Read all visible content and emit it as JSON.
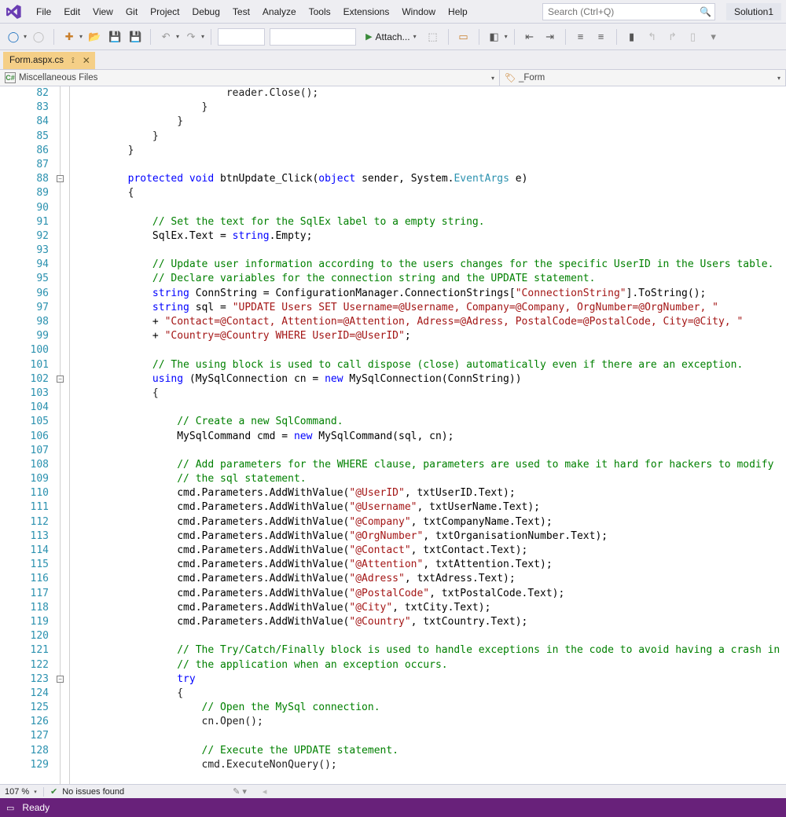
{
  "menu": {
    "items": [
      "File",
      "Edit",
      "View",
      "Git",
      "Project",
      "Debug",
      "Test",
      "Analyze",
      "Tools",
      "Extensions",
      "Window",
      "Help"
    ]
  },
  "search": {
    "placeholder": "Search (Ctrl+Q)"
  },
  "solution_label": "Solution1",
  "toolbar": {
    "attach_label": "Attach..."
  },
  "tab": {
    "title": "Form.aspx.cs"
  },
  "nav": {
    "left": "Miscellaneous Files",
    "right": "_Form"
  },
  "line_start": 82,
  "code": [
    "                        reader.Close();",
    "                    }",
    "                }",
    "            }",
    "        }",
    "",
    {
      "seg": [
        [
          "        ",
          "p"
        ],
        [
          "protected",
          "k"
        ],
        [
          " ",
          "p"
        ],
        [
          "void",
          "k"
        ],
        [
          " btnUpdate_Click(",
          "p"
        ],
        [
          "object",
          "k"
        ],
        [
          " sender, System.",
          "p"
        ],
        [
          "EventArgs",
          "t"
        ],
        [
          " e)",
          "p"
        ]
      ]
    },
    "        {",
    "",
    {
      "seg": [
        [
          "            ",
          "p"
        ],
        [
          "// Set the text for the SqlEx label to a empty string.",
          "c"
        ]
      ]
    },
    {
      "seg": [
        [
          "            SqlEx.Text = ",
          "p"
        ],
        [
          "string",
          "k"
        ],
        [
          ".Empty;",
          "p"
        ]
      ]
    },
    "",
    {
      "seg": [
        [
          "            ",
          "p"
        ],
        [
          "// Update user information according to the users changes for the specific UserID in the Users table.",
          "c"
        ]
      ]
    },
    {
      "seg": [
        [
          "            ",
          "p"
        ],
        [
          "// Declare variables for the connection string and the UPDATE statement.",
          "c"
        ]
      ]
    },
    {
      "seg": [
        [
          "            ",
          "p"
        ],
        [
          "string",
          "k"
        ],
        [
          " ConnString = ConfigurationManager.ConnectionStrings[",
          "p"
        ],
        [
          "\"ConnectionString\"",
          "s"
        ],
        [
          "].ToString();",
          "p"
        ]
      ]
    },
    {
      "seg": [
        [
          "            ",
          "p"
        ],
        [
          "string",
          "k"
        ],
        [
          " sql = ",
          "p"
        ],
        [
          "\"UPDATE Users SET Username=@Username, Company=@Company, OrgNumber=@OrgNumber, \"",
          "s"
        ]
      ]
    },
    {
      "seg": [
        [
          "            + ",
          "p"
        ],
        [
          "\"Contact=@Contact, Attention=@Attention, Adress=@Adress, PostalCode=@PostalCode, City=@City, \"",
          "s"
        ]
      ]
    },
    {
      "seg": [
        [
          "            + ",
          "p"
        ],
        [
          "\"Country=@Country WHERE UserID=@UserID\"",
          "s"
        ],
        [
          ";",
          "p"
        ]
      ]
    },
    "",
    {
      "seg": [
        [
          "            ",
          "p"
        ],
        [
          "// The using block is used to call dispose (close) automatically even if there are an exception.",
          "c"
        ]
      ]
    },
    {
      "seg": [
        [
          "            ",
          "p"
        ],
        [
          "using",
          "k"
        ],
        [
          " (MySqlConnection cn = ",
          "p"
        ],
        [
          "new",
          "k"
        ],
        [
          " MySqlConnection(ConnString))",
          "p"
        ]
      ]
    },
    "            {",
    "",
    {
      "seg": [
        [
          "                ",
          "p"
        ],
        [
          "// Create a new SqlCommand.",
          "c"
        ]
      ]
    },
    {
      "seg": [
        [
          "                MySqlCommand cmd = ",
          "p"
        ],
        [
          "new",
          "k"
        ],
        [
          " MySqlCommand(sql, cn);",
          "p"
        ]
      ]
    },
    "",
    {
      "seg": [
        [
          "                ",
          "p"
        ],
        [
          "// Add parameters for the WHERE clause, parameters are used to make it hard for hackers to modify",
          "c"
        ]
      ]
    },
    {
      "seg": [
        [
          "                ",
          "p"
        ],
        [
          "// the sql statement.",
          "c"
        ]
      ]
    },
    {
      "seg": [
        [
          "                cmd.Parameters.AddWithValue(",
          "p"
        ],
        [
          "\"@UserID\"",
          "s"
        ],
        [
          ", txtUserID.Text);",
          "p"
        ]
      ]
    },
    {
      "seg": [
        [
          "                cmd.Parameters.AddWithValue(",
          "p"
        ],
        [
          "\"@Username\"",
          "s"
        ],
        [
          ", txtUserName.Text);",
          "p"
        ]
      ]
    },
    {
      "seg": [
        [
          "                cmd.Parameters.AddWithValue(",
          "p"
        ],
        [
          "\"@Company\"",
          "s"
        ],
        [
          ", txtCompanyName.Text);",
          "p"
        ]
      ]
    },
    {
      "seg": [
        [
          "                cmd.Parameters.AddWithValue(",
          "p"
        ],
        [
          "\"@OrgNumber\"",
          "s"
        ],
        [
          ", txtOrganisationNumber.Text);",
          "p"
        ]
      ]
    },
    {
      "seg": [
        [
          "                cmd.Parameters.AddWithValue(",
          "p"
        ],
        [
          "\"@Contact\"",
          "s"
        ],
        [
          ", txtContact.Text);",
          "p"
        ]
      ]
    },
    {
      "seg": [
        [
          "                cmd.Parameters.AddWithValue(",
          "p"
        ],
        [
          "\"@Attention\"",
          "s"
        ],
        [
          ", txtAttention.Text);",
          "p"
        ]
      ]
    },
    {
      "seg": [
        [
          "                cmd.Parameters.AddWithValue(",
          "p"
        ],
        [
          "\"@Adress\"",
          "s"
        ],
        [
          ", txtAdress.Text);",
          "p"
        ]
      ]
    },
    {
      "seg": [
        [
          "                cmd.Parameters.AddWithValue(",
          "p"
        ],
        [
          "\"@PostalCode\"",
          "s"
        ],
        [
          ", txtPostalCode.Text);",
          "p"
        ]
      ]
    },
    {
      "seg": [
        [
          "                cmd.Parameters.AddWithValue(",
          "p"
        ],
        [
          "\"@City\"",
          "s"
        ],
        [
          ", txtCity.Text);",
          "p"
        ]
      ]
    },
    {
      "seg": [
        [
          "                cmd.Parameters.AddWithValue(",
          "p"
        ],
        [
          "\"@Country\"",
          "s"
        ],
        [
          ", txtCountry.Text);",
          "p"
        ]
      ]
    },
    "",
    {
      "seg": [
        [
          "                ",
          "p"
        ],
        [
          "// The Try/Catch/Finally block is used to handle exceptions in the code to avoid having a crash in",
          "c"
        ]
      ]
    },
    {
      "seg": [
        [
          "                ",
          "p"
        ],
        [
          "// the application when an exception occurs.",
          "c"
        ]
      ]
    },
    {
      "seg": [
        [
          "                ",
          "p"
        ],
        [
          "try",
          "k"
        ]
      ]
    },
    "                {",
    {
      "seg": [
        [
          "                    ",
          "p"
        ],
        [
          "// Open the MySql connection.",
          "c"
        ]
      ]
    },
    "                    cn.Open();",
    "",
    {
      "seg": [
        [
          "                    ",
          "p"
        ],
        [
          "// Execute the UPDATE statement.",
          "c"
        ]
      ]
    },
    "                    cmd.ExecuteNonQuery();"
  ],
  "fold_rows": [
    6,
    20,
    41
  ],
  "status_top": {
    "zoom": "107 %",
    "issues": "No issues found"
  },
  "status_bar": {
    "ready": "Ready"
  }
}
